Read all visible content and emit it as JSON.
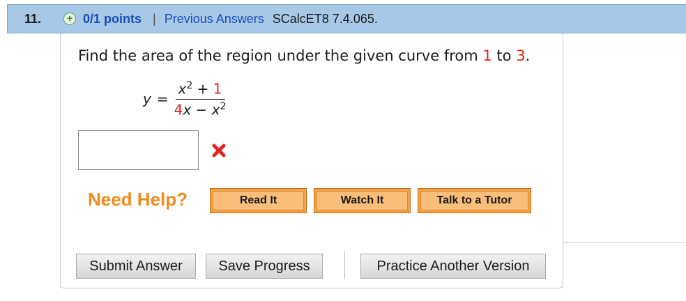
{
  "header": {
    "number": "11.",
    "points": "0/1 points",
    "separator": "|",
    "previous_answers": "Previous Answers",
    "reference": "SCalcET8 7.4.065."
  },
  "question": {
    "prefix": "Find the area of the region under the given curve from ",
    "from": "1",
    "middle": " to ",
    "to": "3",
    "suffix": "."
  },
  "formula": {
    "lhs": "y",
    "equals": "=",
    "num_base": "x",
    "num_exp": "2",
    "num_plus": " + ",
    "num_const": "1",
    "den_coef": "4",
    "den_var": "x − x",
    "den_exp": "2"
  },
  "answer": {
    "value": "",
    "status_icon": "x-icon",
    "status_color": "#e0231d"
  },
  "help": {
    "label": "Need Help?",
    "read_it": "Read It",
    "watch_it": "Watch It",
    "talk_to_tutor": "Talk to a Tutor"
  },
  "actions": {
    "submit": "Submit Answer",
    "save": "Save Progress",
    "practice": "Practice Another Version"
  },
  "colors": {
    "accent_red": "#e0231d",
    "help_orange": "#f08b1e",
    "header_blue": "#a7c8e6",
    "link_blue": "#1a4fb5"
  }
}
